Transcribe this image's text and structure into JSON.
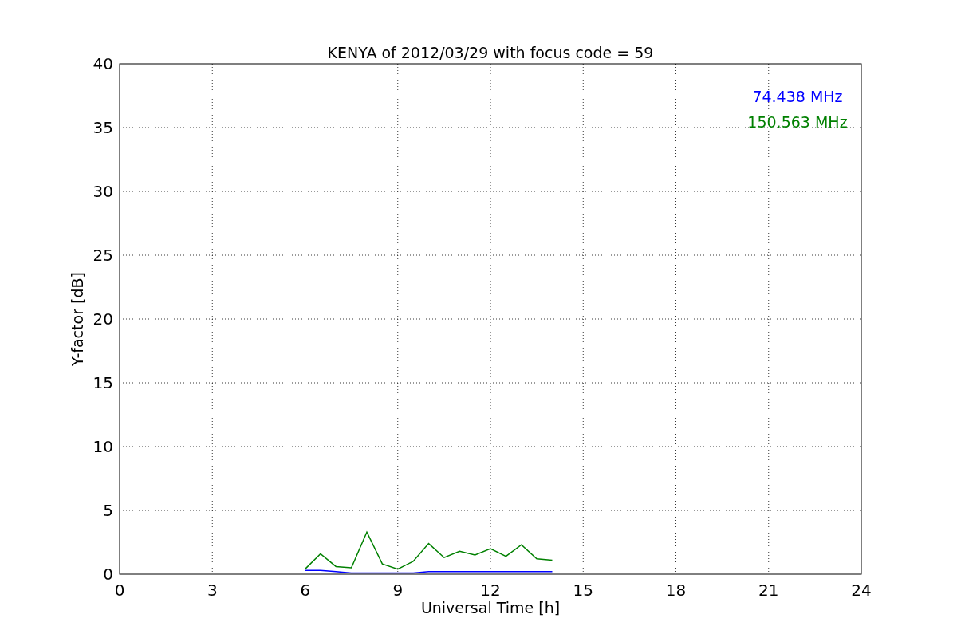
{
  "chart_data": {
    "type": "line",
    "title": "KENYA of 2012/03/29 with focus code = 59",
    "xlabel": "Universal Time [h]",
    "ylabel": "Y-factor [dB]",
    "x": [
      6,
      6.5,
      7,
      7.5,
      8,
      8.5,
      9,
      9.5,
      10,
      10.5,
      11,
      11.5,
      12,
      12.5,
      13,
      13.5,
      14
    ],
    "series": [
      {
        "name": "74.438 MHz",
        "color": "#0000ff",
        "values": [
          0.3,
          0.3,
          0.2,
          0.1,
          0.1,
          0.1,
          0.1,
          0.1,
          0.2,
          0.2,
          0.2,
          0.2,
          0.2,
          0.2,
          0.2,
          0.2,
          0.2
        ]
      },
      {
        "name": "150.563 MHz",
        "color": "#008000",
        "values": [
          0.4,
          1.6,
          0.6,
          0.5,
          3.3,
          0.8,
          0.4,
          1.0,
          2.4,
          1.3,
          1.8,
          1.5,
          2.0,
          1.4,
          2.3,
          1.2,
          1.1
        ]
      }
    ],
    "xlim": [
      0,
      24
    ],
    "ylim": [
      0,
      40
    ],
    "xticks": [
      0,
      3,
      6,
      9,
      12,
      15,
      18,
      21,
      24
    ],
    "yticks": [
      0,
      5,
      10,
      15,
      20,
      25,
      30,
      35,
      40
    ],
    "grid": true
  }
}
